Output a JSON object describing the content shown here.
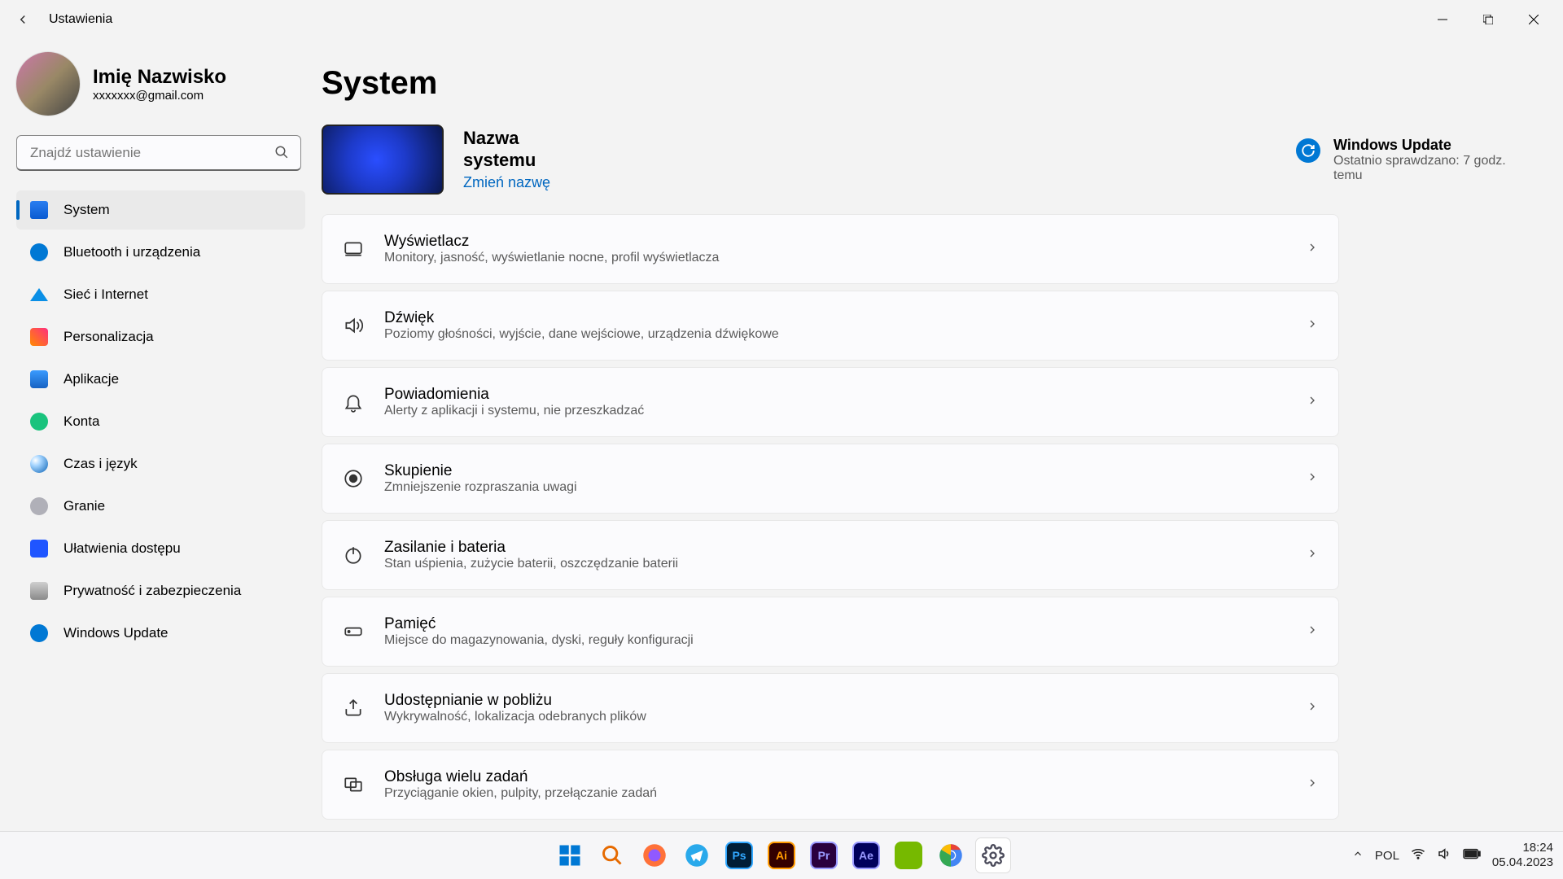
{
  "window": {
    "title": "Ustawienia"
  },
  "user": {
    "name": "Imię Nazwisko",
    "email": "xxxxxxx@gmail.com"
  },
  "search": {
    "placeholder": "Znajdź ustawienie"
  },
  "nav": {
    "system": "System",
    "bluetooth": "Bluetooth i urządzenia",
    "network": "Sieć i Internet",
    "personalization": "Personalizacja",
    "apps": "Aplikacje",
    "accounts": "Konta",
    "time": "Czas i język",
    "gaming": "Granie",
    "accessibility": "Ułatwienia dostępu",
    "privacy": "Prywatność i zabezpieczenia",
    "update": "Windows Update"
  },
  "page": {
    "heading": "System",
    "systemNameLine1": "Nazwa",
    "systemNameLine2": "systemu",
    "rename": "Zmień nazwę",
    "wuTitle": "Windows Update",
    "wuSub": "Ostatnio sprawdzano: 7 godz. temu"
  },
  "cards": {
    "display": {
      "title": "Wyświetlacz",
      "sub": "Monitory, jasność, wyświetlanie nocne, profil wyświetlacza"
    },
    "sound": {
      "title": "Dźwięk",
      "sub": "Poziomy głośności, wyjście, dane wejściowe, urządzenia dźwiękowe"
    },
    "notifications": {
      "title": "Powiadomienia",
      "sub": "Alerty z aplikacji i systemu, nie przeszkadzać"
    },
    "focus": {
      "title": "Skupienie",
      "sub": "Zmniejszenie rozpraszania uwagi"
    },
    "power": {
      "title": "Zasilanie i bateria",
      "sub": "Stan uśpienia, zużycie baterii, oszczędzanie baterii"
    },
    "storage": {
      "title": "Pamięć",
      "sub": "Miejsce do magazynowania, dyski, reguły konfiguracji"
    },
    "nearby": {
      "title": "Udostępnianie w pobliżu",
      "sub": "Wykrywalność, lokalizacja odebranych plików"
    },
    "multitask": {
      "title": "Obsługa wielu zadań",
      "sub": "Przyciąganie okien, pulpity, przełączanie zadań"
    }
  },
  "tray": {
    "keyboard": "POL",
    "time": "18:24",
    "date": "05.04.2023"
  }
}
